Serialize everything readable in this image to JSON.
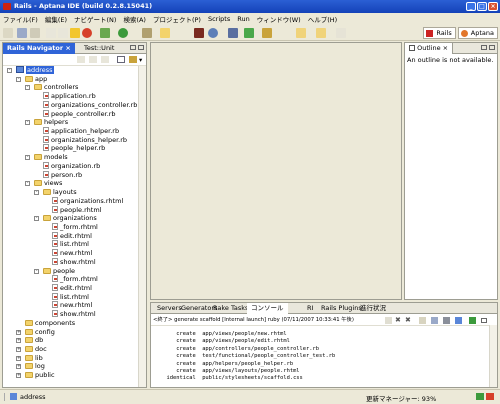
{
  "window": {
    "title": "Rails - Aptana IDE (build 0.2.8.15041)"
  },
  "menu": [
    "ファイル(F)",
    "編集(E)",
    "ナビゲート(N)",
    "検索(A)",
    "プロジェクト(P)",
    "Scripts",
    "Run",
    "ウィンドウ(W)",
    "ヘルプ(H)"
  ],
  "perspectives": [
    "Rails",
    "Aptana"
  ],
  "navigator": {
    "tab_active": "Rails Navigator",
    "tab_other": "Test::Unit",
    "tree": [
      {
        "label": "address",
        "kind": "project",
        "depth": 0,
        "twisty": "-",
        "selected": true
      },
      {
        "label": "app",
        "kind": "folder",
        "depth": 1,
        "twisty": "-"
      },
      {
        "label": "controllers",
        "kind": "folder",
        "depth": 2,
        "twisty": "-"
      },
      {
        "label": "application.rb",
        "kind": "file",
        "depth": 3
      },
      {
        "label": "organizations_controller.rb",
        "kind": "file",
        "depth": 3
      },
      {
        "label": "people_controller.rb",
        "kind": "file",
        "depth": 3
      },
      {
        "label": "helpers",
        "kind": "folder",
        "depth": 2,
        "twisty": "-"
      },
      {
        "label": "application_helper.rb",
        "kind": "file",
        "depth": 3
      },
      {
        "label": "organizations_helper.rb",
        "kind": "file",
        "depth": 3
      },
      {
        "label": "people_helper.rb",
        "kind": "file",
        "depth": 3
      },
      {
        "label": "models",
        "kind": "folder",
        "depth": 2,
        "twisty": "-"
      },
      {
        "label": "organization.rb",
        "kind": "file",
        "depth": 3
      },
      {
        "label": "person.rb",
        "kind": "file",
        "depth": 3
      },
      {
        "label": "views",
        "kind": "folder",
        "depth": 2,
        "twisty": "-"
      },
      {
        "label": "layouts",
        "kind": "folder",
        "depth": 3,
        "twisty": "-"
      },
      {
        "label": "organizations.rhtml",
        "kind": "file",
        "depth": 4
      },
      {
        "label": "people.rhtml",
        "kind": "file",
        "depth": 4
      },
      {
        "label": "organizations",
        "kind": "folder",
        "depth": 3,
        "twisty": "-"
      },
      {
        "label": "_form.rhtml",
        "kind": "file",
        "depth": 4
      },
      {
        "label": "edit.rhtml",
        "kind": "file",
        "depth": 4
      },
      {
        "label": "list.rhtml",
        "kind": "file",
        "depth": 4
      },
      {
        "label": "new.rhtml",
        "kind": "file",
        "depth": 4
      },
      {
        "label": "show.rhtml",
        "kind": "file",
        "depth": 4
      },
      {
        "label": "people",
        "kind": "folder",
        "depth": 3,
        "twisty": "-"
      },
      {
        "label": "_form.rhtml",
        "kind": "file",
        "depth": 4
      },
      {
        "label": "edit.rhtml",
        "kind": "file",
        "depth": 4
      },
      {
        "label": "list.rhtml",
        "kind": "file",
        "depth": 4
      },
      {
        "label": "new.rhtml",
        "kind": "file",
        "depth": 4
      },
      {
        "label": "show.rhtml",
        "kind": "file",
        "depth": 4
      },
      {
        "label": "components",
        "kind": "folder",
        "depth": 1
      },
      {
        "label": "config",
        "kind": "folder",
        "depth": 1,
        "twisty": "+"
      },
      {
        "label": "db",
        "kind": "folder",
        "depth": 1,
        "twisty": "+"
      },
      {
        "label": "doc",
        "kind": "folder",
        "depth": 1,
        "twisty": "+"
      },
      {
        "label": "lib",
        "kind": "folder",
        "depth": 1,
        "twisty": "+"
      },
      {
        "label": "log",
        "kind": "folder",
        "depth": 1,
        "twisty": "+"
      },
      {
        "label": "public",
        "kind": "folder",
        "depth": 1,
        "twisty": "+"
      }
    ]
  },
  "outline": {
    "tab": "Outline",
    "message": "An outline is not available."
  },
  "bottom": {
    "tabs": [
      "Servers",
      "Generators",
      "Rake Tasks",
      "コンソール",
      "RI",
      "Rails Plugins",
      "進行状況"
    ],
    "console_header": "<終了> generate scaffold [Internal launch] ruby (07/11/2007 10:33:41 午後)",
    "console_lines": [
      "     create  app/views/people/new.rhtml",
      "     create  app/views/people/edit.rhtml",
      "     create  app/controllers/people_controller.rb",
      "     create  test/functional/people_controller_test.rb",
      "     create  app/helpers/people_helper.rb",
      "     create  app/views/layouts/people.rhtml",
      "  identical  public/stylesheets/scaffold.css"
    ]
  },
  "status": {
    "selection": "address",
    "memory": "更新マネージャー: 93%"
  },
  "colors": {
    "accent": "#2f64d8",
    "titlebar": "#1442b8",
    "folder": "#f3d36b"
  }
}
